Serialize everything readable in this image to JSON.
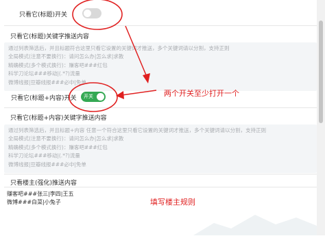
{
  "section1": {
    "switch_label": "只看它(标题)开关",
    "switch_on": false,
    "field_label": "只看它(标题)关键字推送内容",
    "hint_lines": [
      "通过列表筛选后，并且标题符合这里只看它设置的关键词才推送，多个关键词请以分割，支持正则",
      "全局模式(注意不要换行)：请问怎么办|怎么求|求教",
      "精确模式(多个模式换行)：赚客吧###红包",
      "科学刀论坛###移动|(.*?)流量",
      "微博线报|豆瓣线报###必中|免单"
    ]
  },
  "section2": {
    "switch_label": "只看它(标题+内容)开关",
    "switch_on": true,
    "switch_text": "开关",
    "field_label": "只看它(标题+内容)关键字推送内容",
    "hint_lines": [
      "通过列表筛选后，并且标题+内容 任意一个符合这里只看它设置的关键词才推送，多个关键词请以分割，支持正则",
      "全局模式(注意不要换行)：请问怎么办|怎么求|求教",
      "精确模式(多个模式换行)：赚客吧###红包",
      "科学刀论坛###移动|(.*?)流量",
      "微博线报|豆瓣线报###必中|免单"
    ]
  },
  "section3": {
    "field_label": "只看楼主(强化)推送内容",
    "value_lines": [
      "赚客吧###张三|李四|王五",
      "微博###白菜|小兔子"
    ]
  },
  "annotations": {
    "both_switch_note": "两个开关至少打开一个",
    "owner_rule_note": "填写楼主规则"
  },
  "colors": {
    "accent_green": "#34a853",
    "annotation_red": "#e02020"
  }
}
